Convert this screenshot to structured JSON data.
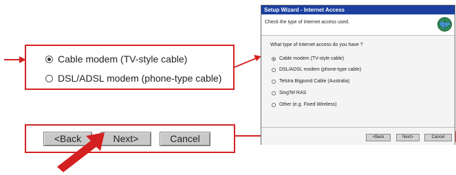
{
  "zoom": {
    "options": [
      {
        "label": "Cable modem (TV-style cable)",
        "checked": true
      },
      {
        "label": "DSL/ADSL modem (phone-type cable)",
        "checked": false
      }
    ],
    "buttons": {
      "back": "<Back",
      "next": "Next>",
      "cancel": "Cancel"
    }
  },
  "wizard": {
    "title": "Setup Wizard - Internet Access",
    "subtitle": "Check the type of Internet access used.",
    "question": "What type of Internet access do you have ?",
    "options": [
      {
        "label": "Cable modem (TV-style cable)",
        "checked": true
      },
      {
        "label": "DSL/ADSL modem (phone-type cable)",
        "checked": false
      },
      {
        "label": "Telstra Bigpond Cable (Australia)",
        "checked": false
      },
      {
        "label": "SingTel RAS",
        "checked": false
      },
      {
        "label": "Other (e.g. Fixed Wireless)",
        "checked": false
      }
    ],
    "buttons": {
      "back": "<Back",
      "next": "Next>",
      "cancel": "Cancel"
    }
  },
  "colors": {
    "highlight": "#d42020",
    "titlebar": "#1a3f9e"
  }
}
